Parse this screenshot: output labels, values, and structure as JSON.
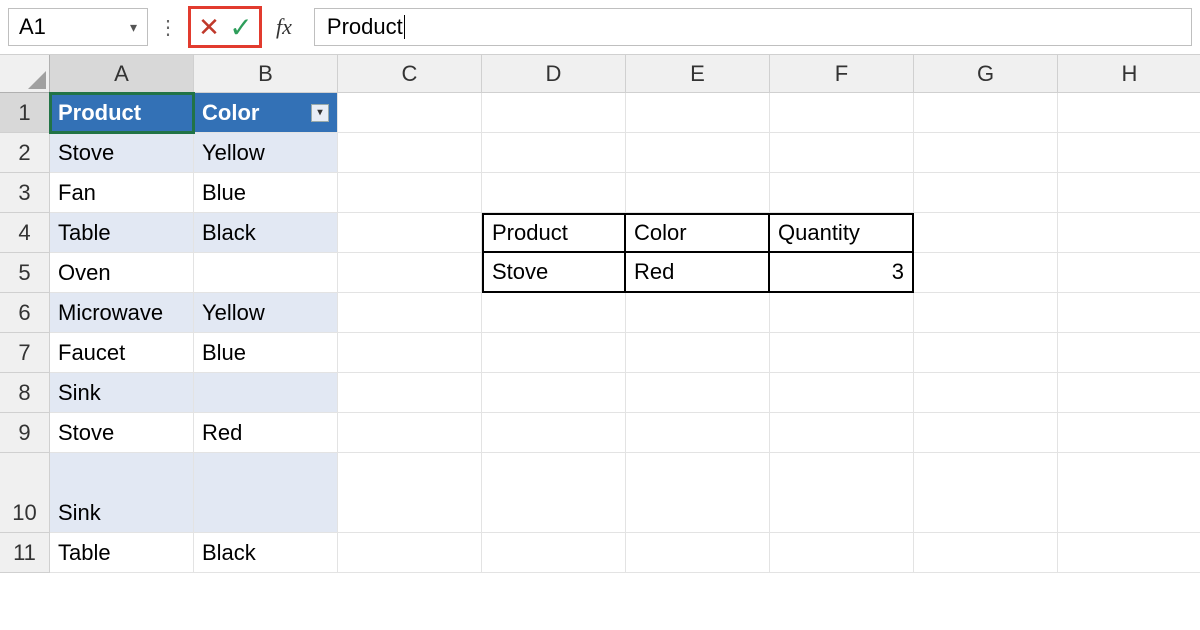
{
  "namebox": "A1",
  "formula_value": "Product",
  "columns": [
    "A",
    "B",
    "C",
    "D",
    "E",
    "F",
    "G",
    "H"
  ],
  "rows": [
    "1",
    "2",
    "3",
    "4",
    "5",
    "6",
    "7",
    "8",
    "9",
    "10",
    "11"
  ],
  "table": {
    "headers": {
      "a": "Product",
      "b": "Color"
    },
    "rows": [
      {
        "a": "Stove",
        "b": "Yellow"
      },
      {
        "a": "Fan",
        "b": "Blue"
      },
      {
        "a": "Table",
        "b": "Black"
      },
      {
        "a": "Oven",
        "b": ""
      },
      {
        "a": "Microwave",
        "b": "Yellow"
      },
      {
        "a": "Faucet",
        "b": "Blue"
      },
      {
        "a": "Sink",
        "b": ""
      },
      {
        "a": "Stove",
        "b": "Red"
      },
      {
        "a": "Sink",
        "b": ""
      },
      {
        "a": "Table",
        "b": "Black"
      }
    ]
  },
  "mini": {
    "headers": {
      "d": "Product",
      "e": "Color",
      "f": "Quantity"
    },
    "row": {
      "d": "Stove",
      "e": "Red",
      "f": "3"
    }
  }
}
